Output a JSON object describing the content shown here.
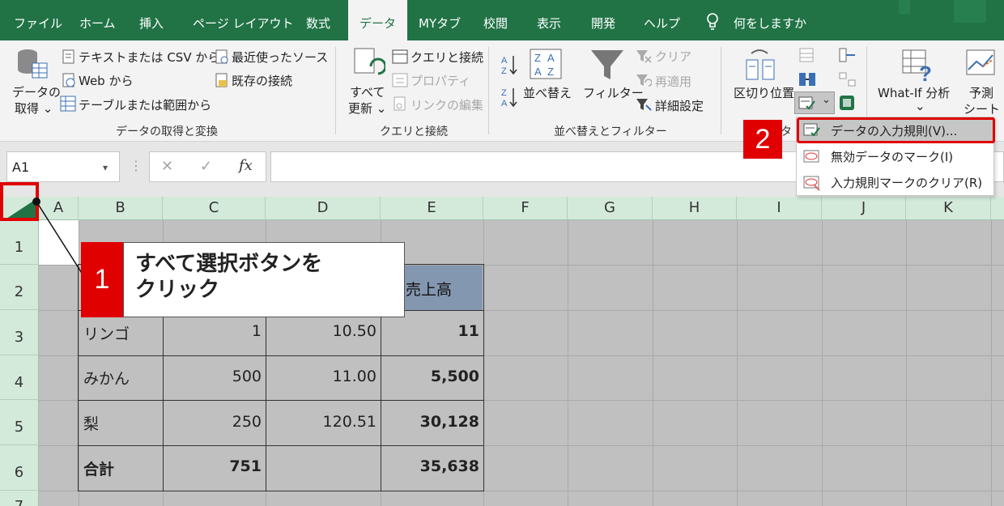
{
  "tabs": [
    "ファイル",
    "ホーム",
    "挿入",
    "ページ レイアウト",
    "数式",
    "データ",
    "MYタブ",
    "校閲",
    "表示",
    "開発",
    "ヘルプ"
  ],
  "active_tab": "データ",
  "tell_me": "何をしますか",
  "ribbon": {
    "get_data_line1": "データの",
    "get_data_line2": "取得 ⌄",
    "from_text_csv": "テキストまたは CSV から",
    "from_web": "Web から",
    "from_table": "テーブルまたは範囲から",
    "recent_sources": "最近使ったソース",
    "existing_conn": "既存の接続",
    "group_get": "データの取得と変換",
    "refresh_line1": "すべて",
    "refresh_line2": "更新 ⌄",
    "queries_conn": "クエリと接続",
    "properties": "プロパティ",
    "edit_links": "リンクの編集",
    "group_queries": "クエリと接続",
    "sort": "並べ替え",
    "filter": "フィルター",
    "clear": "クリア",
    "reapply": "再適用",
    "advanced": "詳細設定",
    "group_sort": "並べ替えとフィルター",
    "text_to_columns": "区切り位置",
    "group_data_tools_partial": "タ",
    "what_if": "What-If 分析",
    "what_if_arrow": "⌄",
    "forecast_line1": "予測",
    "forecast_line2": "シート"
  },
  "formula_bar": {
    "name_box": "A1",
    "cancel": "✕",
    "enter": "✓",
    "fx": "fx"
  },
  "columns": [
    "A",
    "B",
    "C",
    "D",
    "E",
    "F",
    "G",
    "H",
    "I",
    "J",
    "K"
  ],
  "rows": [
    "1",
    "2",
    "3",
    "4",
    "5",
    "6",
    "7"
  ],
  "table": {
    "header_e": "売上高",
    "rows": [
      {
        "b": "リンゴ",
        "c": "1",
        "d": "10.50",
        "e": "11"
      },
      {
        "b": "みかん",
        "c": "500",
        "d": "11.00",
        "e": "5,500"
      },
      {
        "b": "梨",
        "c": "250",
        "d": "120.51",
        "e": "30,128"
      },
      {
        "b": "合計",
        "c": "751",
        "d": "",
        "e": "35,638"
      }
    ]
  },
  "callout1": {
    "number": "1",
    "text": "すべて選択ボタンを\nクリック"
  },
  "callout2": {
    "number": "2"
  },
  "menu": [
    {
      "label": "データの入力規則(V)..."
    },
    {
      "label": "無効データのマーク(I)"
    },
    {
      "label": "入力規則マークのクリア(R)"
    }
  ],
  "colors": {
    "excel_green": "#217346",
    "highlight_red": "#e00000"
  }
}
